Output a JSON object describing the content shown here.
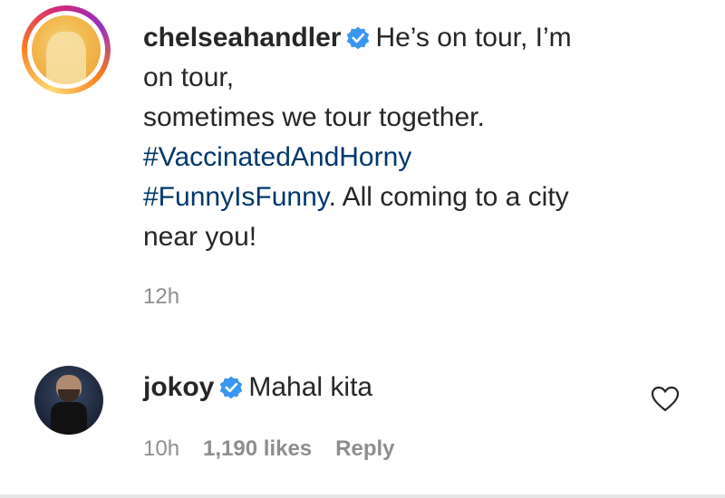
{
  "caption": {
    "username": "chelseahandler",
    "text_line1": "He’s on tour, I’m",
    "text_line2": "on tour,",
    "text_line3": "sometimes we tour together.",
    "hashtag1": "#VaccinatedAndHorny",
    "hashtag2": "#FunnyIsFunny",
    "text_after_hashtag2": ". All coming to a city",
    "text_line_last": "near you!",
    "timestamp": "12h"
  },
  "comment": {
    "username": "jokoy",
    "text": "Mahal kita",
    "timestamp": "10h",
    "likes": "1,190 likes",
    "reply_label": "Reply"
  },
  "icons": {
    "verified": "verified-badge-icon",
    "like": "heart-outline-icon"
  },
  "colors": {
    "verified_blue": "#3897f0",
    "hashtag": "#00376b",
    "secondary_text": "#8e8e8e",
    "primary_text": "#262626"
  }
}
